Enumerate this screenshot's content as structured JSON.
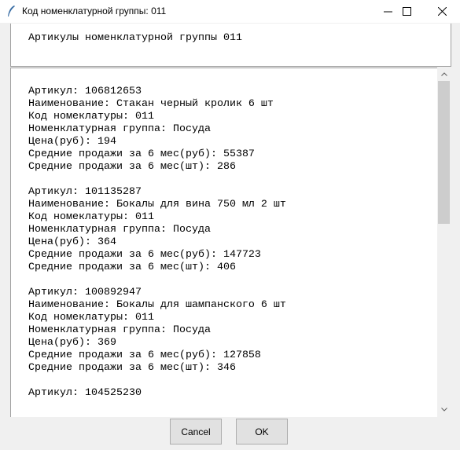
{
  "window": {
    "title": "Код номенклатурной группы: 011",
    "icon": "feather-icon"
  },
  "header": {
    "text": "Артикулы номенклатурной группы 011"
  },
  "content": {
    "lines": [
      "Артикул: 106812653",
      "Наименование: Стакан черный кролик 6 шт",
      "Код номеклатуры: 011",
      "Номенклатурная группа: Посуда",
      "Цена(руб): 194",
      "Средние продажи за 6 мес(руб): 55387",
      "Средние продажи за 6 мес(шт): 286",
      "",
      "Артикул: 101135287",
      "Наименование: Бокалы для вина 750 мл 2 шт",
      "Код номеклатуры: 011",
      "Номенклатурная группа: Посуда",
      "Цена(руб): 364",
      "Средние продажи за 6 мес(руб): 147723",
      "Средние продажи за 6 мес(шт): 406",
      "",
      "Артикул: 100892947",
      "Наименование: Бокалы для шампанского 6 шт",
      "Код номеклатуры: 011",
      "Номенклатурная группа: Посуда",
      "Цена(руб): 369",
      "Средние продажи за 6 мес(руб): 127858",
      "Средние продажи за 6 мес(шт): 346",
      "",
      "Артикул: 104525230"
    ]
  },
  "buttons": {
    "cancel": "Cancel",
    "ok": "OK"
  }
}
